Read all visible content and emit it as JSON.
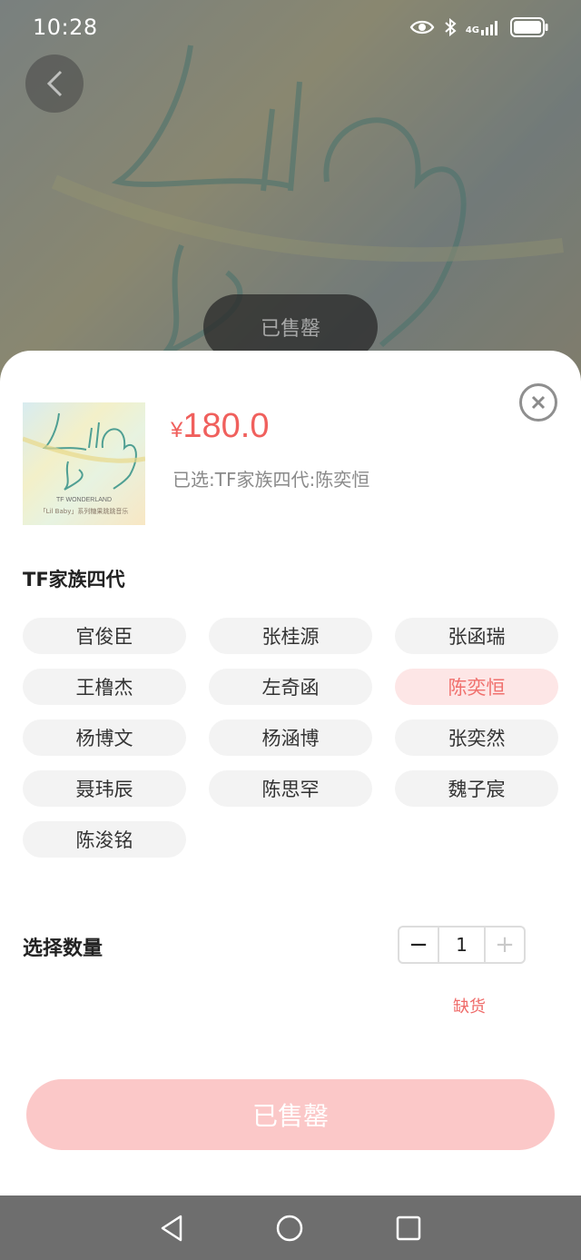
{
  "status_bar": {
    "time": "10:28",
    "network": "4G"
  },
  "hero": {
    "overlay_label": "已售罄"
  },
  "product": {
    "currency": "¥",
    "price": "180.0",
    "selected_text": "已选:TF家族四代:陈奕恒",
    "thumbnail": {
      "line1": "TF WONDERLAND",
      "line2": "「Lil Baby」系列糖果跳跳音乐"
    }
  },
  "variant_group": {
    "title": "TF家族四代",
    "options": [
      "官俊臣",
      "张桂源",
      "张函瑞",
      "王橹杰",
      "左奇函",
      "陈奕恒",
      "杨博文",
      "杨涵博",
      "张奕然",
      "聂玮辰",
      "陈思罕",
      "魏子宸",
      "陈浚铭"
    ],
    "selected": "陈奕恒"
  },
  "quantity": {
    "label": "选择数量",
    "minus": "−",
    "value": "1",
    "plus": "+",
    "stock_status": "缺货"
  },
  "action": {
    "label": "已售罄"
  },
  "colors": {
    "accent": "#f0605d",
    "selected_bg": "#fde6e6",
    "disabled_button": "#fbc8c8"
  },
  "icons": [
    "back-icon",
    "eye-icon",
    "bluetooth-icon",
    "signal-icon",
    "battery-icon",
    "close-icon",
    "nav-back-icon",
    "nav-home-icon",
    "nav-recents-icon"
  ]
}
